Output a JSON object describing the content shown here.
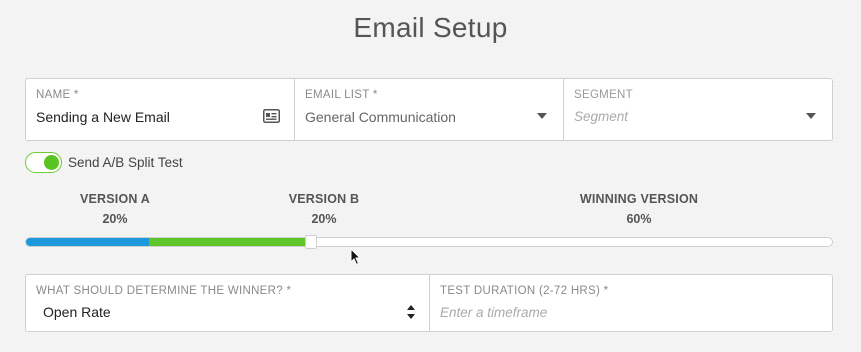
{
  "page": {
    "title": "Email Setup"
  },
  "fields": {
    "name": {
      "label": "NAME *",
      "value": "Sending a New Email",
      "icon": "contact-card-icon"
    },
    "email_list": {
      "label": "EMAIL LIST *",
      "value": "General Communication"
    },
    "segment": {
      "label": "SEGMENT",
      "placeholder": "Segment"
    }
  },
  "ab_toggle": {
    "label": "Send A/B Split Test",
    "on": true
  },
  "split": {
    "version_a": {
      "label": "VERSION A",
      "percent": "20%",
      "value": 20,
      "color": "#1c98dc"
    },
    "version_b": {
      "label": "VERSION B",
      "percent": "20%",
      "value": 20,
      "color": "#5fc62a"
    },
    "winning": {
      "label": "WINNING VERSION",
      "percent": "60%",
      "value": 60
    }
  },
  "winner": {
    "criteria": {
      "label": "WHAT SHOULD DETERMINE THE WINNER? *",
      "value": "Open Rate"
    },
    "duration": {
      "label": "TEST DURATION (2-72 HRS) *",
      "placeholder": "Enter a timeframe"
    }
  }
}
